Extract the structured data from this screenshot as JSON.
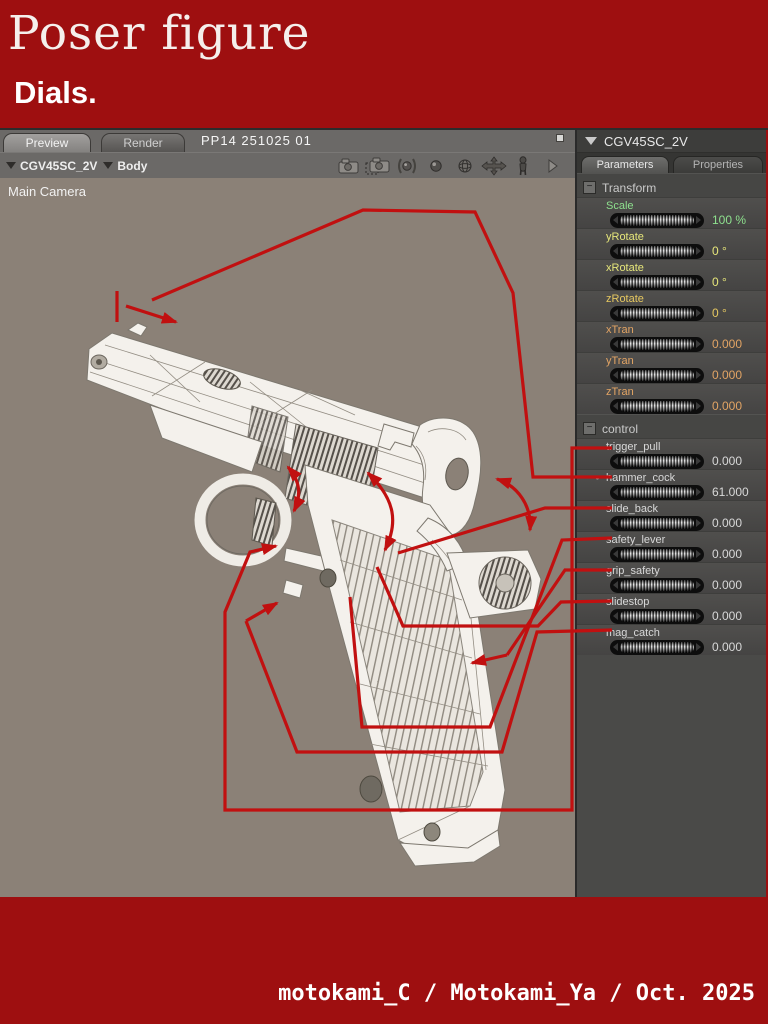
{
  "banner": {
    "title": "Poser figure",
    "subtitle": "Dials."
  },
  "credit": {
    "text": "motokami_C / Motokami_Ya / Oct. 2025"
  },
  "workspace": {
    "tabs": [
      {
        "label": "Preview",
        "active": true
      },
      {
        "label": "Render",
        "active": false
      }
    ],
    "document_title": "PP14 251025 01",
    "actor_selector": "CGV45SC_2V",
    "body_selector": "Body",
    "toolbar_icons": [
      "camera-icon",
      "camera-select-icon",
      "ball-bracket-icon",
      "sphere-icon",
      "wire-sphere-icon",
      "move-cross-icon",
      "figure-icon",
      "arrow-right-icon"
    ],
    "viewport_label": "Main Camera"
  },
  "panel": {
    "header": "CGV45SC_2V",
    "tabs": [
      {
        "label": "Parameters",
        "active": true
      },
      {
        "label": "Properties",
        "active": false
      }
    ],
    "sections": [
      {
        "title": "Transform",
        "dials": [
          {
            "label": "Scale",
            "value": "100 %",
            "color": "#8ee08e"
          },
          {
            "label": "yRotate",
            "value": "0 °",
            "color": "#e6e67a"
          },
          {
            "label": "xRotate",
            "value": "0 °",
            "color": "#e6e67a"
          },
          {
            "label": "zRotate",
            "value": "0 °",
            "color": "#e6c860"
          },
          {
            "label": "xTran",
            "value": "0.000",
            "color": "#e2a464"
          },
          {
            "label": "yTran",
            "value": "0.000",
            "color": "#e2a464"
          },
          {
            "label": "zTran",
            "value": "0.000",
            "color": "#e2a464"
          }
        ]
      },
      {
        "title": "control",
        "dials": [
          {
            "label": "trigger_pull",
            "value": "0.000",
            "color": "#d8d8d8"
          },
          {
            "label": "hammer_cock",
            "value": "61.000",
            "color": "#d8d8d8",
            "marked": true
          },
          {
            "label": "slide_back",
            "value": "0.000",
            "color": "#d8d8d8"
          },
          {
            "label": "safety_lever",
            "value": "0.000",
            "color": "#d8d8d8"
          },
          {
            "label": "grip_safety",
            "value": "0.000",
            "color": "#d8d8d8"
          },
          {
            "label": "slidestop",
            "value": "0.000",
            "color": "#d8d8d8"
          },
          {
            "label": "mag_catch",
            "value": "0.000",
            "color": "#d8d8d8"
          }
        ]
      }
    ]
  },
  "annotations": {
    "color": "#c11010",
    "items": [
      {
        "name": "muzzle-pointer",
        "target": "muzzle"
      },
      {
        "name": "trigger-pull-callout",
        "target_dial": "trigger_pull"
      },
      {
        "name": "hammer-cock-callout",
        "target_dial": "hammer_cock"
      },
      {
        "name": "slide-back-callout",
        "target_dial": "slide_back"
      },
      {
        "name": "safety-lever-callout",
        "target_dial": "safety_lever"
      },
      {
        "name": "grip-safety-callout",
        "target_dial": "grip_safety"
      },
      {
        "name": "slidestop-callout",
        "target_dial": "slidestop"
      },
      {
        "name": "mag-catch-callout",
        "target_dial": "mag_catch"
      },
      {
        "name": "slide-serration-motion-arrow",
        "target": "slide serrations"
      },
      {
        "name": "slide-stop-motion-arrow",
        "target": "slide stop"
      },
      {
        "name": "hammer-motion-arrow",
        "target": "hammer"
      }
    ]
  },
  "colors": {
    "banner": "#9e0f10",
    "viewport_bg": "#8b8177",
    "panel_bg": "#4a4a48",
    "annotation_red": "#c11010",
    "scale_green": "#8ee08e",
    "rotate_yellow": "#e6e67a",
    "tran_orange": "#e2a464"
  },
  "model": {
    "figure_name": "CGV45SC_2V",
    "subject": "wireframe 1911 pistol 3D preview"
  }
}
